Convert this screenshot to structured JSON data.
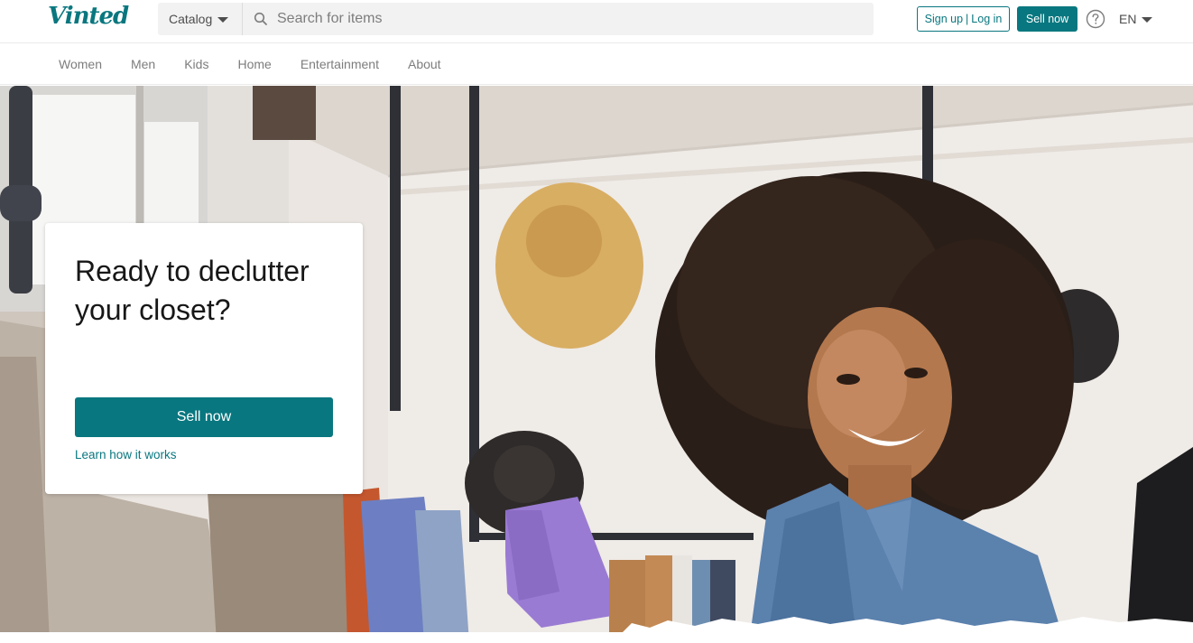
{
  "header": {
    "logo_text": "Vinted",
    "catalog_label": "Catalog",
    "search_placeholder": "Search for items",
    "signup_label": "Sign up",
    "signup_separator": "|",
    "login_label": "Log in",
    "sell_now_label": "Sell now",
    "language_label": "EN"
  },
  "nav": {
    "items": [
      "Women",
      "Men",
      "Kids",
      "Home",
      "Entertainment",
      "About"
    ]
  },
  "hero": {
    "title": "Ready to declutter your closet?",
    "sell_button_label": "Sell now",
    "learn_link_label": "Learn how it works"
  },
  "colors": {
    "brand": "#09777f",
    "text": "#171717",
    "muted": "#7d7d7d"
  },
  "icons": {
    "search": "search-icon",
    "help": "help-circle-icon",
    "caret": "caret-down-icon"
  }
}
